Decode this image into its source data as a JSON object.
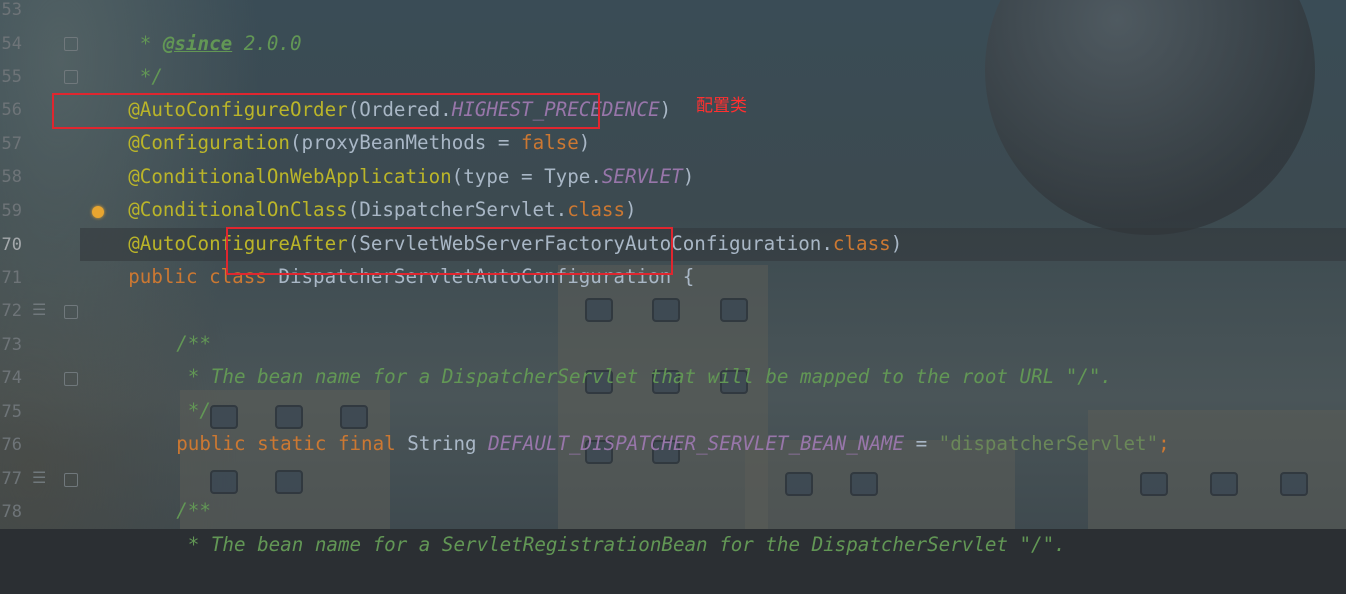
{
  "gutter": {
    "line_numbers": [
      "53",
      "54",
      "55",
      "56",
      "57",
      "58",
      "59",
      "70",
      "71",
      "72",
      "73",
      "74",
      "75",
      "76",
      "77",
      "78"
    ]
  },
  "annotation_note": "配置类",
  "code": {
    "l53": {
      "star": " * ",
      "tag": "@since",
      "rest": " 2.0.0"
    },
    "l54": {
      "text": " */"
    },
    "l55": {
      "ann": "@AutoConfigureOrder",
      "p1": "(",
      "id": "Ordered",
      "dot": ".",
      "const": "HIGHEST_PRECEDENCE",
      "p2": ")"
    },
    "l56": {
      "ann": "@Configuration",
      "p1": "(",
      "id": "proxyBeanMethods",
      "eq": " = ",
      "val": "false",
      "p2": ")"
    },
    "l57": {
      "ann": "@ConditionalOnWebApplication",
      "p1": "(",
      "id": "type",
      "eq": " = ",
      "cls": "Type.",
      "const": "SERVLET",
      "p2": ")"
    },
    "l58": {
      "ann": "@ConditionalOnClass",
      "p1": "(",
      "id": "DispatcherServlet",
      "dot": ".",
      "kw": "class",
      "p2": ")"
    },
    "l59": {
      "ann_pre": "@",
      "ann": "AutoConfigureAfter",
      "p1": "(",
      "id": "ServletWebServerFactoryAutoConfiguration",
      "dot": ".",
      "kw": "class",
      "p2": ")"
    },
    "l70": {
      "kw": "public class ",
      "cls": "DispatcherServletAutoConfiguration",
      "brace": " {"
    },
    "l72": {
      "text": "/**"
    },
    "l73": {
      "text": " * The bean name for a DispatcherServlet that will be mapped to the root URL \"/\"."
    },
    "l74": {
      "text": " */"
    },
    "l75": {
      "kw": "public static final ",
      "type": "String ",
      "field": "DEFAULT_DISPATCHER_SERVLET_BEAN_NAME",
      "eq": " = ",
      "str": "\"dispatcherServlet\"",
      "semi": ";"
    },
    "l77": {
      "text": "/**"
    },
    "l78": {
      "text": " * The bean name for a ServletRegistrationBean for the DispatcherServlet \"/\"."
    }
  }
}
